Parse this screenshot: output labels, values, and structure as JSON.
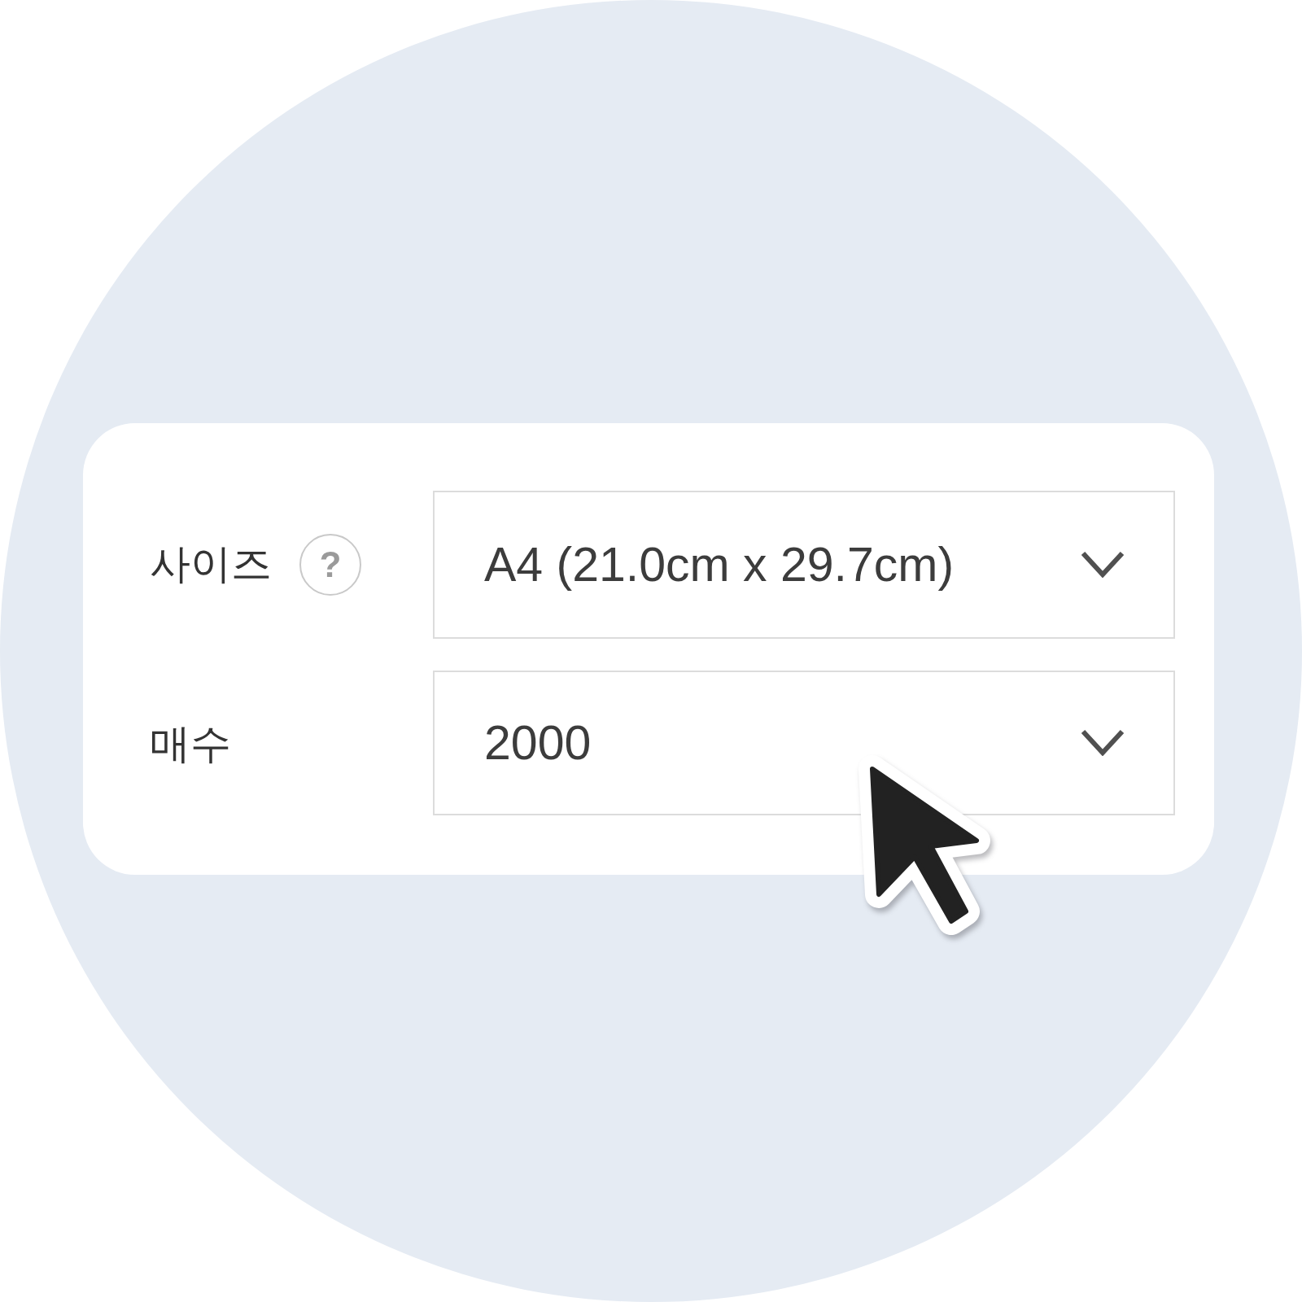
{
  "form": {
    "fields": [
      {
        "label": "사이즈",
        "help": "?",
        "value": "A4 (21.0cm x 29.7cm)"
      },
      {
        "label": "매수",
        "value": "2000"
      }
    ]
  }
}
